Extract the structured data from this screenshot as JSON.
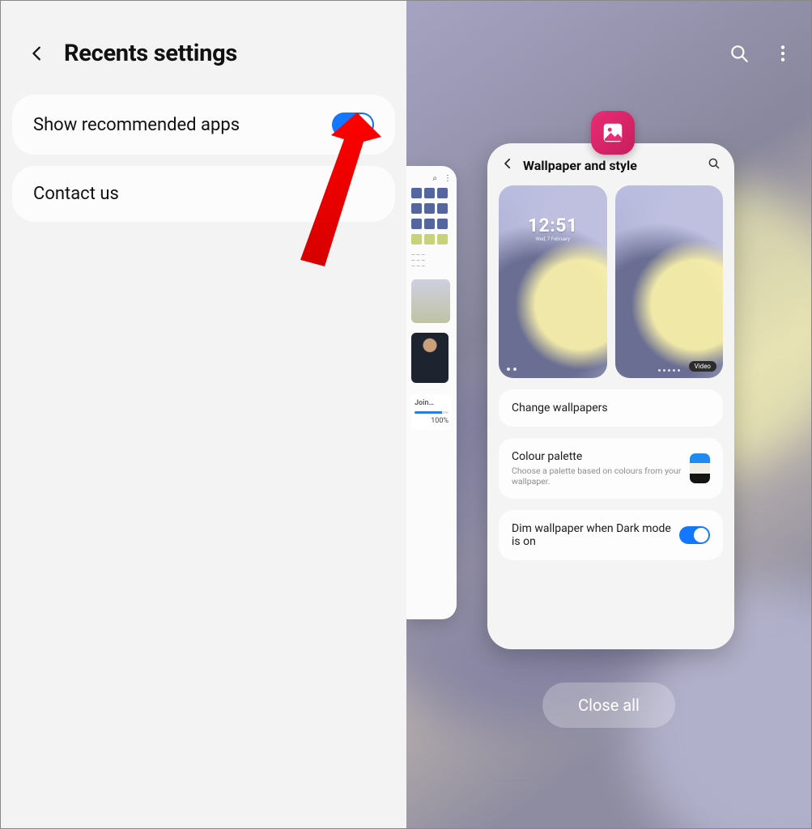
{
  "left": {
    "title": "Recents settings",
    "items": {
      "show_recommended": {
        "label": "Show recommended apps",
        "enabled": true
      },
      "contact_us": {
        "label": "Contact us"
      }
    }
  },
  "right": {
    "topbar": {
      "search_icon": "search-icon",
      "more_icon": "more-icon"
    },
    "app_icon": "gallery-icon",
    "recent_card": {
      "title": "Wallpaper and style",
      "lock_preview": {
        "clock": "12:51",
        "date": "Wed, 7 February"
      },
      "home_preview": {
        "badge": "Video"
      },
      "change_wallpapers": "Change wallpapers",
      "colour_palette": {
        "title": "Colour palette",
        "subtitle": "Choose a palette based on colours from your wallpaper."
      },
      "dim": {
        "label": "Dim wallpaper when Dark mode is on",
        "enabled": true
      }
    },
    "prev_card": {
      "download": {
        "label": "Join…",
        "percent": "100%"
      }
    },
    "close_all": "Close all"
  },
  "annotation": {
    "arrow": "red-arrow-pointing-to-toggle"
  }
}
